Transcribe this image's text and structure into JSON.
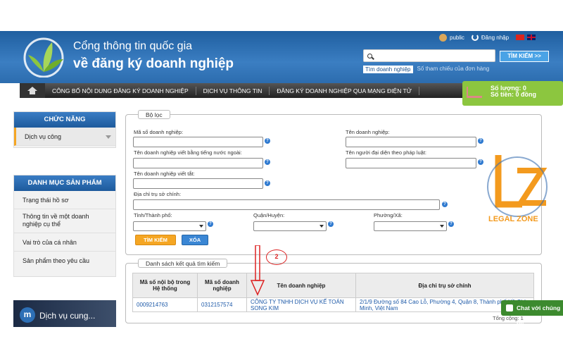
{
  "header": {
    "title_line1": "Cổng thông tin quốc gia",
    "title_line2": "về đăng ký doanh nghiệp",
    "user": "public",
    "login": "Đăng nhập",
    "search_button": "TÌM KIẾM >>",
    "search_tabs": [
      "Tìm doanh nghiệp",
      "Số tham chiếu của đơn hàng"
    ]
  },
  "nav": {
    "items": [
      "CÔNG BỐ NỘI DUNG ĐĂNG KÝ DOANH NGHIỆP",
      "DỊCH VỤ THÔNG TIN",
      "ĐĂNG KÝ DOANH NGHIỆP QUA MẠNG ĐIỆN TỬ"
    ]
  },
  "cart": {
    "quantity": "Số lượng: 0",
    "amount": "Số tiền: 0 đồng"
  },
  "sidebar": {
    "functions_title": "CHỨC NĂNG",
    "functions_item": "Dịch vụ công",
    "products_title": "DANH MỤC SẢN PHẨM",
    "products_items": [
      "Trạng thái hồ sơ",
      "Thông tin về một doanh nghiệp cụ thể",
      "Vai trò của cá nhân",
      "Sản phẩm theo yêu cầu"
    ]
  },
  "filter": {
    "legend": "Bộ lọc",
    "enterprise_code": "Mã số doanh nghiệp:",
    "enterprise_name": "Tên doanh nghiệp:",
    "foreign_name": "Tên doanh nghiệp viết bằng tiếng nước ngoài:",
    "legal_rep": "Tên người đại diện theo pháp luật:",
    "short_name": "Tên doanh nghiệp viết tắt:",
    "address": "Địa chỉ trụ sở chính:",
    "province": "Tỉnh/Thành phố:",
    "district": "Quận/Huyện:",
    "ward": "Phường/Xã:",
    "search_button": "TÌM KIẾM",
    "clear_button": "XÓA"
  },
  "results": {
    "legend": "Danh sách kết quả tìm kiếm",
    "headers": [
      "Mã số nội bộ trong Hệ thống",
      "Mã số doanh nghiệp",
      "Tên doanh nghiệp",
      "Địa chỉ trụ sở chính"
    ],
    "rows": [
      [
        "0009214763",
        "0312157574",
        "CÔNG TY TNHH DỊCH VỤ KẾ TOÁN SONG KIM",
        "2/1/9 Đường số 84 Cao Lỗ, Phường 4, Quận 8, Thành phố Hồ Chí Minh, Việt Nam"
      ]
    ],
    "total": "Tổng cộng: 1"
  },
  "annotation": {
    "step": "2"
  },
  "watermark": {
    "text": "LEGAL ZONE"
  },
  "video": {
    "avatar": "m",
    "title": "Dịch vụ cung..."
  },
  "chat": {
    "label": "Chat với chúng tôi"
  }
}
